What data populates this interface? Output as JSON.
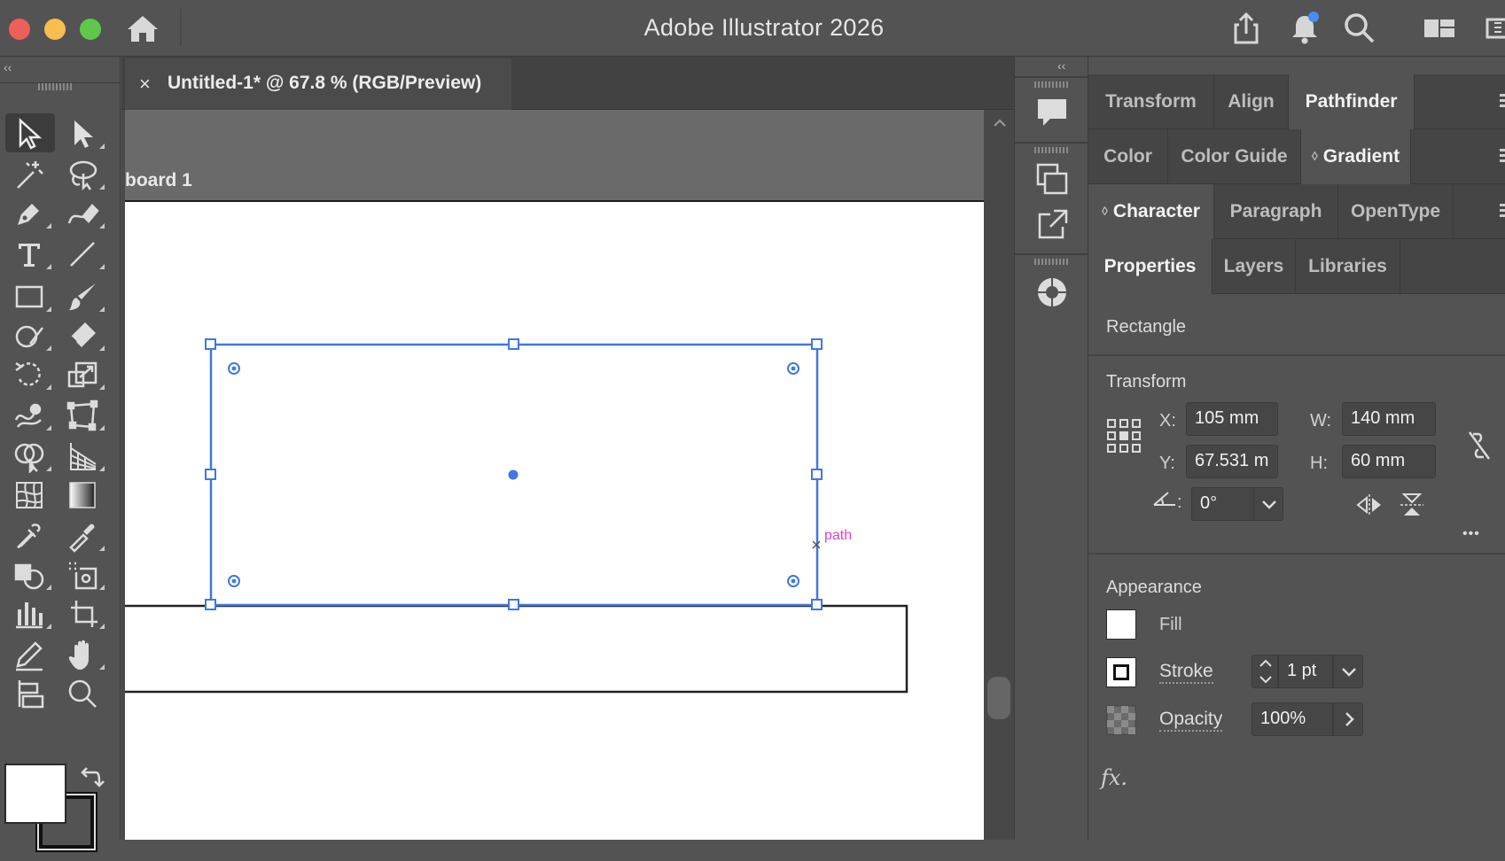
{
  "app": {
    "title": "Adobe Illustrator 2026"
  },
  "titlebar": {
    "icons": [
      "home-icon",
      "share-icon",
      "bell-icon",
      "search-icon",
      "workspace-icon",
      "panel-icon"
    ],
    "colors": {
      "close": "#ed5f59",
      "minimize": "#f5be4f",
      "maximize": "#5fc84b",
      "notification_dot": "#4a8cf0"
    }
  },
  "toolbar": {
    "collapse": "‹‹",
    "tools": [
      "selection-tool",
      "direct-selection-tool",
      "magic-wand-tool",
      "lasso-tool",
      "pen-tool",
      "curvature-tool",
      "type-tool",
      "line-tool",
      "rectangle-tool",
      "paintbrush-tool",
      "shaper-tool",
      "eraser-tool",
      "rotate-tool",
      "scale-tool",
      "warp-tool",
      "free-transform-tool",
      "shape-builder-tool",
      "perspective-grid-tool",
      "mesh-tool",
      "gradient-tool",
      "eyedropper-tool",
      "blend-tool",
      "symbol-sprayer-tool",
      "artboard-tool",
      "graph-tool",
      "slice-tool",
      "pencil-tool",
      "hand-tool",
      "print-tiling-tool",
      "zoom-tool"
    ],
    "fill_color": "#ffffff",
    "stroke_color": "#111111"
  },
  "document": {
    "tab_close": "×",
    "tab_title": "Untitled-1* @ 67.8 % (RGB/Preview)",
    "artboard_label": "board 1",
    "path_label": "path",
    "selection_color": "#3f78e0",
    "path_label_color": "#e040c8"
  },
  "dock": {
    "collapse": "‹‹",
    "buttons": [
      "comments-icon",
      "artboards-icon",
      "export-icon",
      "color-wheel-icon"
    ]
  },
  "panels": {
    "row1": [
      {
        "label": "Transform",
        "active": false
      },
      {
        "label": "Align",
        "active": false
      },
      {
        "label": "Pathfinder",
        "active": true
      }
    ],
    "row2": [
      {
        "label": "Color",
        "active": false
      },
      {
        "label": "Color Guide",
        "active": false
      },
      {
        "label": "Gradient",
        "active": true,
        "marker": "◊"
      }
    ],
    "row3": [
      {
        "label": "Character",
        "active": true,
        "marker": "◊"
      },
      {
        "label": "Paragraph",
        "active": false
      },
      {
        "label": "OpenType",
        "active": false
      }
    ],
    "row4": [
      {
        "label": "Properties",
        "active": true
      },
      {
        "label": "Layers",
        "active": false
      },
      {
        "label": "Libraries",
        "active": false
      }
    ]
  },
  "properties": {
    "object_type": "Rectangle",
    "transform": {
      "title": "Transform",
      "x_label": "X:",
      "x_value": "105 mm",
      "y_label": "Y:",
      "y_value": "67.531 m",
      "w_label": "W:",
      "w_value": "140 mm",
      "h_label": "H:",
      "h_value": "60 mm",
      "angle_label": ":",
      "angle_value": "0°",
      "more": "•••"
    },
    "appearance": {
      "title": "Appearance",
      "fill_label": "Fill",
      "stroke_label": "Stroke",
      "stroke_value": "1 pt",
      "opacity_label": "Opacity",
      "opacity_value": "100%",
      "fx_label": "fx."
    }
  }
}
